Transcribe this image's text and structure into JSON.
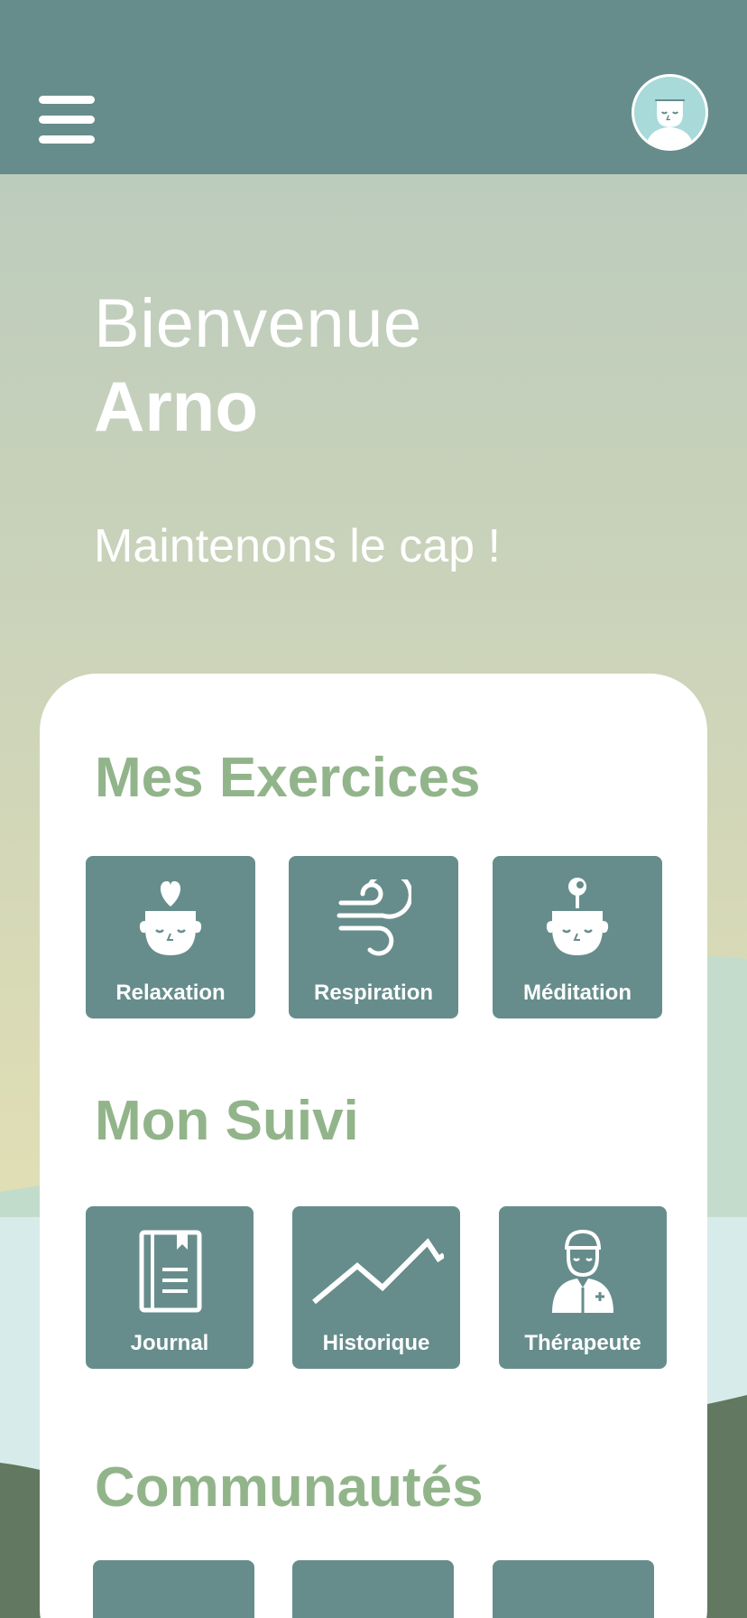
{
  "header": {
    "menu_icon": "hamburger-menu-icon",
    "avatar_icon": "user-face-icon"
  },
  "greeting": {
    "line1": "Bienvenue",
    "name": "Arno",
    "tagline": "Maintenons le cap !"
  },
  "sections": {
    "exercises": {
      "title": "Mes Exercices",
      "items": [
        {
          "label": "Relaxation",
          "icon": "heart-head-icon"
        },
        {
          "label": "Respiration",
          "icon": "wind-icon"
        },
        {
          "label": "Méditation",
          "icon": "pin-head-icon"
        }
      ]
    },
    "tracking": {
      "title": "Mon Suivi",
      "items": [
        {
          "label": "Journal",
          "icon": "notebook-icon"
        },
        {
          "label": "Historique",
          "icon": "trend-line-icon"
        },
        {
          "label": "Thérapeute",
          "icon": "doctor-icon"
        }
      ]
    },
    "communities": {
      "title": "Communautés"
    }
  },
  "colors": {
    "topbar": "#668d8c",
    "tile": "#668d8c",
    "section_title": "#92b48a",
    "avatar_bg": "#a7dad8"
  }
}
